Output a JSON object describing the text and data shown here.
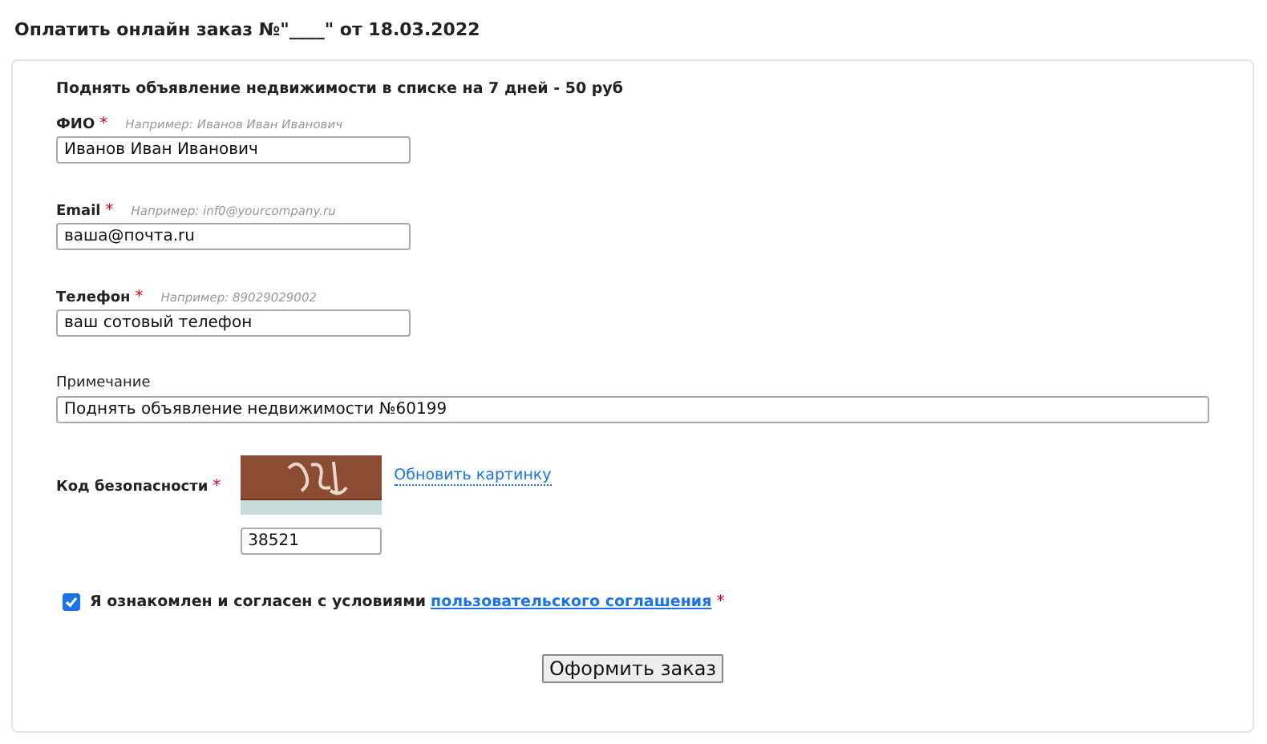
{
  "title": "Оплатить онлайн заказ №\"____\" от 18.03.2022",
  "service": "Поднять объявление недвижимости в списке на 7 дней - 50 руб",
  "fields": [
    {
      "kind": "short",
      "label": "ФИО",
      "required_mark": "*",
      "hint": "Например: Иванов Иван Иванович",
      "value": "Иванов Иван Иванович"
    },
    {
      "kind": "short",
      "label": "Email",
      "required_mark": "*",
      "hint": "Например: inf0@yourcompany.ru",
      "value": "ваша@почта.ru"
    },
    {
      "kind": "short",
      "label": "Телефон",
      "required_mark": "*",
      "hint": "Например: 89029029002",
      "value": "ваш сотовый телефон"
    },
    {
      "kind": "wide",
      "label": "Примечание",
      "value": "Поднять объявление недвижимости №60199"
    }
  ],
  "captcha": {
    "label": "Код безопасности",
    "required_mark": "*",
    "refresh_link": "Обновить картинку",
    "value": "38521"
  },
  "agreement": {
    "checked": true,
    "text": "Я ознакомлен и согласен с условиями",
    "link": "пользовательского соглашения",
    "required_mark": "*"
  },
  "submit": "Оформить заказ"
}
